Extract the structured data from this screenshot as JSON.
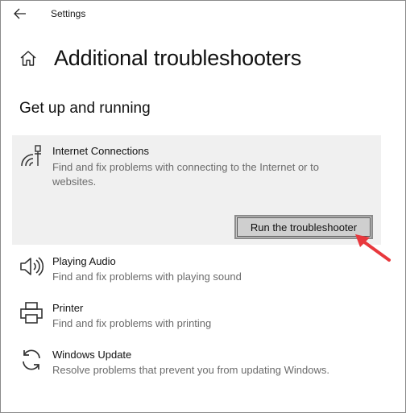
{
  "window": {
    "title": "Settings"
  },
  "page": {
    "title": "Additional troubleshooters",
    "section": "Get up and running"
  },
  "troubleshooters": [
    {
      "name": "Internet Connections",
      "description": "Find and fix problems with connecting to the Internet or to websites.",
      "icon": "wifi-network-icon",
      "selected": true,
      "button_label": "Run the troubleshooter"
    },
    {
      "name": "Playing Audio",
      "description": "Find and fix problems with playing sound",
      "icon": "speaker-icon",
      "selected": false
    },
    {
      "name": "Printer",
      "description": "Find and fix problems with printing",
      "icon": "printer-icon",
      "selected": false
    },
    {
      "name": "Windows Update",
      "description": "Resolve problems that prevent you from updating Windows.",
      "icon": "sync-icon",
      "selected": false
    }
  ],
  "colors": {
    "selected_bg": "#f0f0f0",
    "annotation_arrow": "#e8383d",
    "description_text": "#6b6b6b"
  }
}
